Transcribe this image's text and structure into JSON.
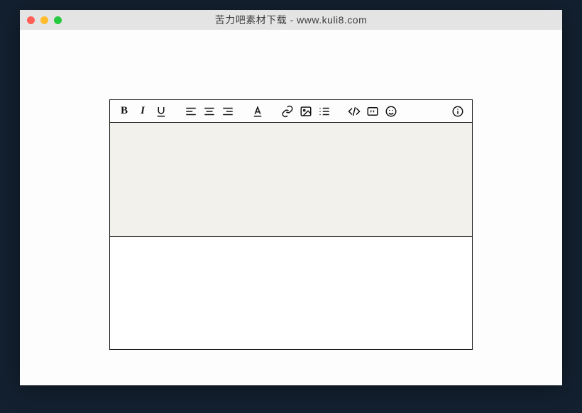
{
  "window": {
    "title": "苦力吧素材下载 - www.kuli8.com"
  },
  "toolbar": {
    "groups": {
      "text": {
        "bold": "B",
        "italic": "I",
        "underline": "U"
      },
      "align": {
        "left": "align-left",
        "center": "align-center",
        "right": "align-right"
      },
      "color": "text-color",
      "insert": {
        "link": "link",
        "image": "image",
        "list": "list"
      },
      "block": {
        "code": "code",
        "quote": "quote",
        "emoji": "emoji"
      },
      "info": "info"
    }
  },
  "editor": {
    "content": "",
    "output": ""
  }
}
